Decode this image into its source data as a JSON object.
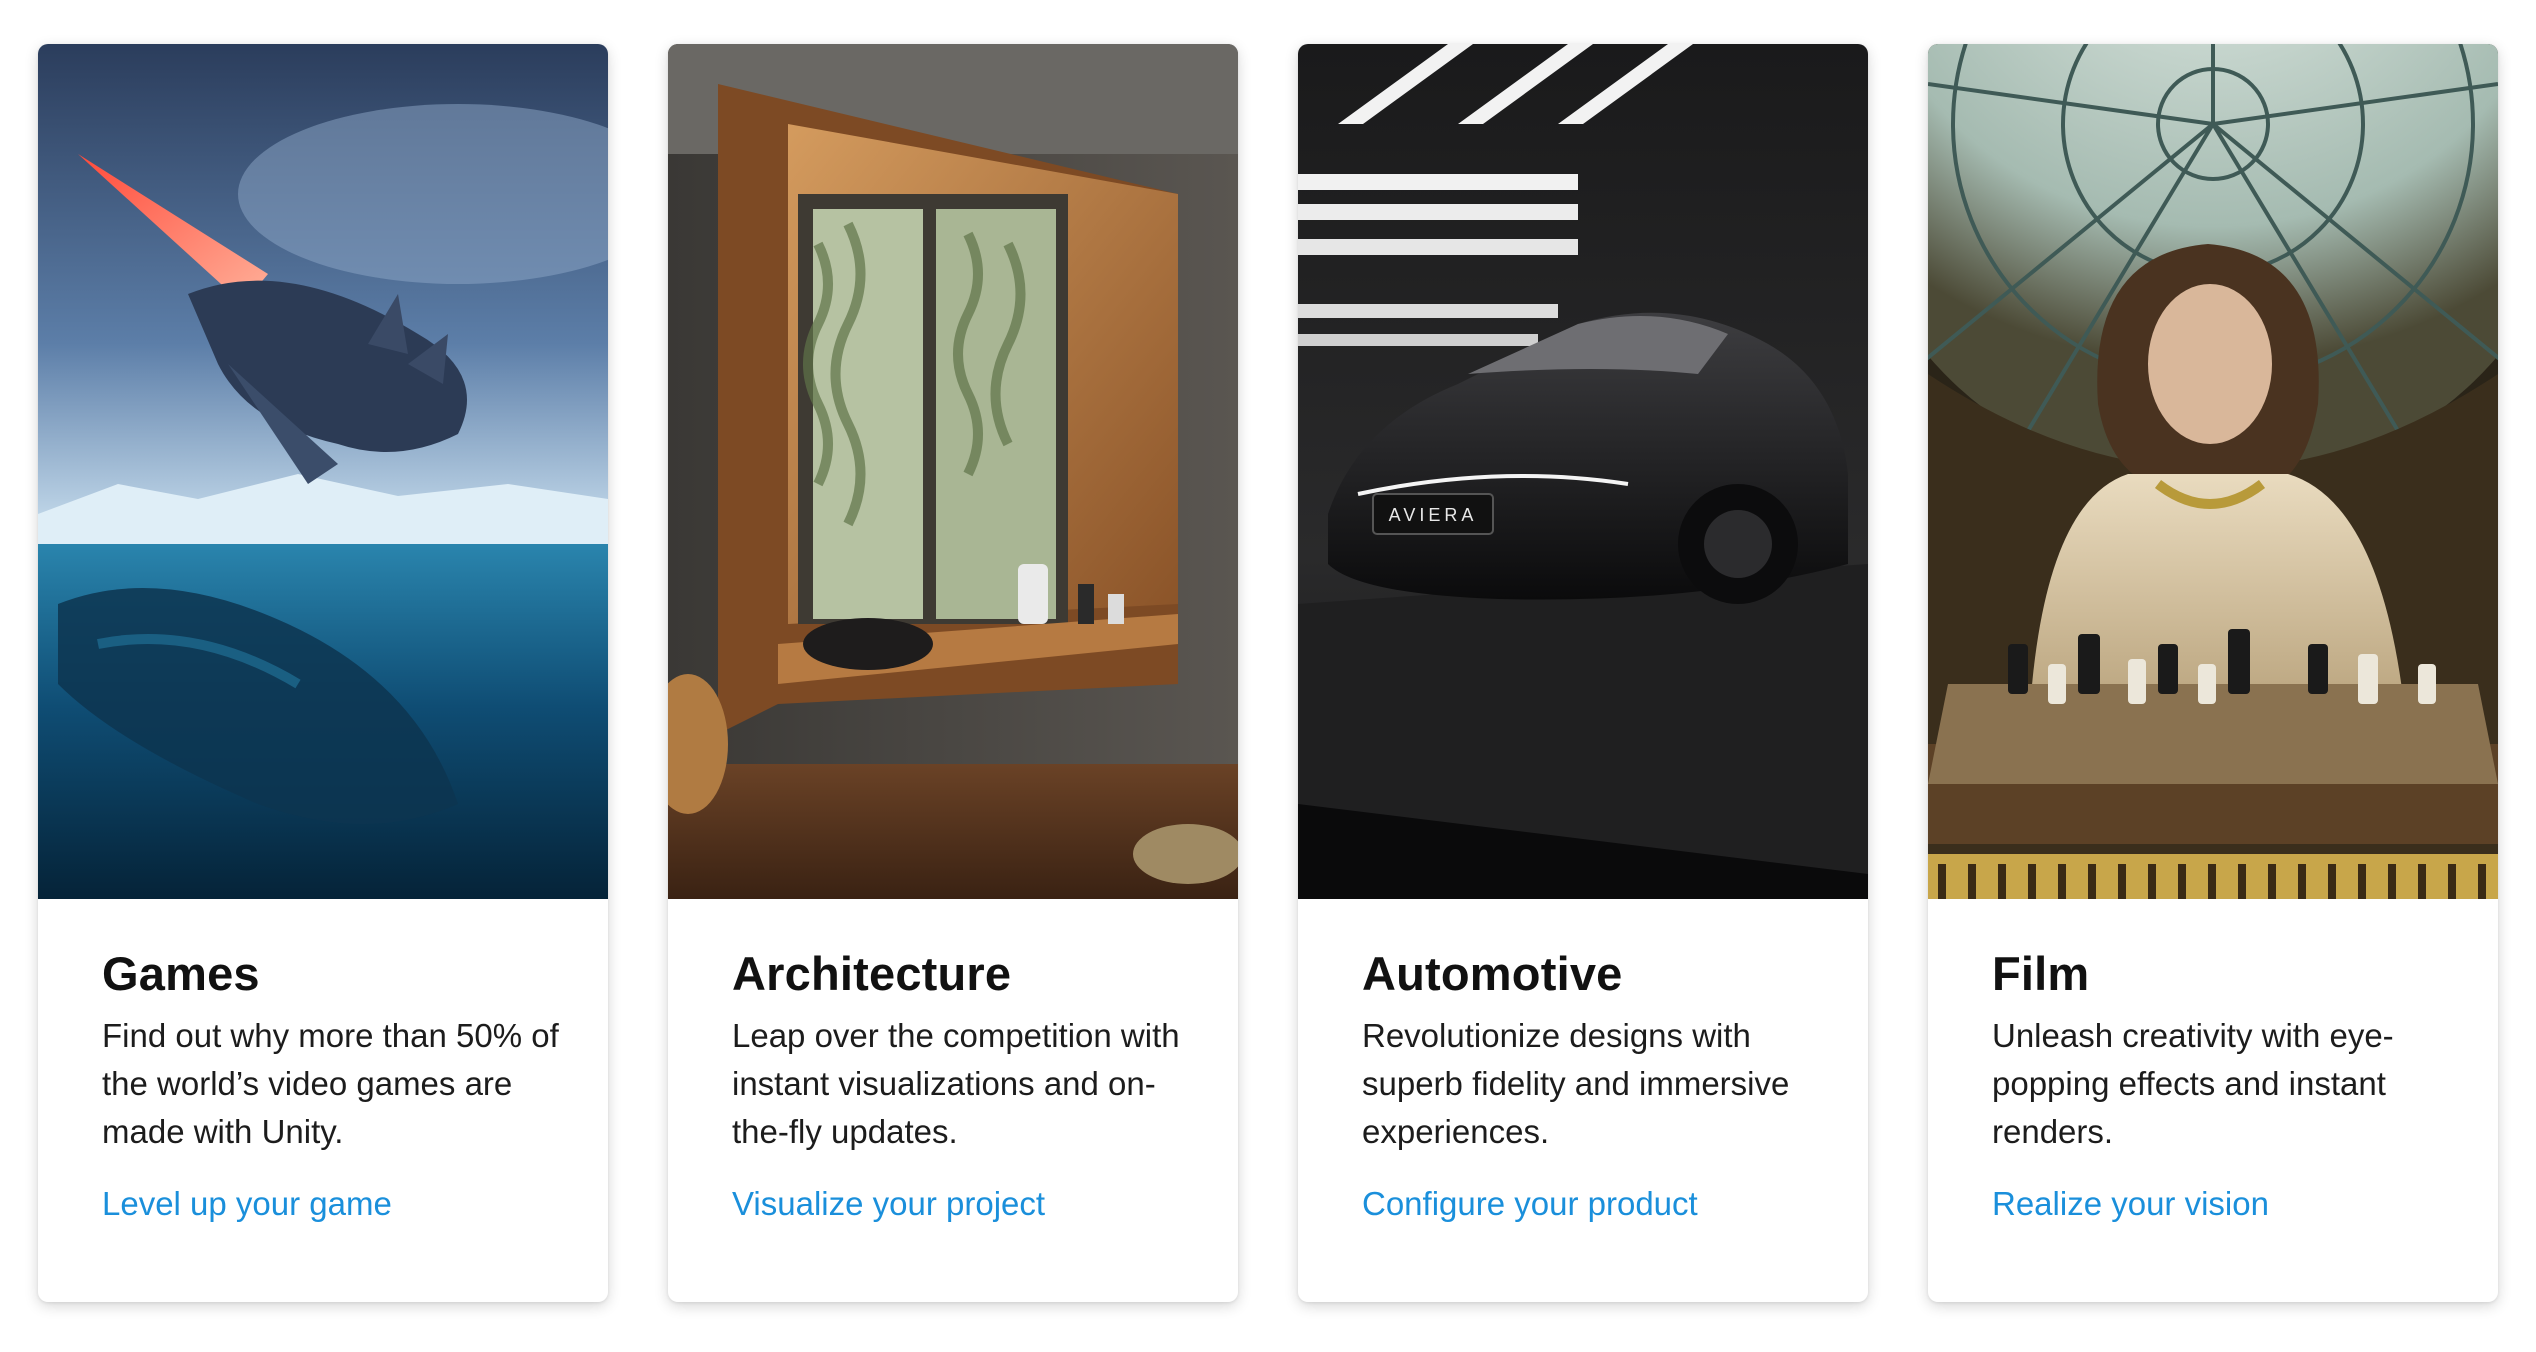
{
  "cards": [
    {
      "title": "Games",
      "description": "Find out why more than 50% of the world’s video games are made with Unity.",
      "link": "Level up your game",
      "image": "underwater-sea-creature-scene"
    },
    {
      "title": "Architecture",
      "description": "Leap over the competition with instant visualizations and on-the-fly updates.",
      "link": "Visualize your project",
      "image": "wooden-window-nook-interior"
    },
    {
      "title": "Automotive",
      "description": "Revolutionize designs with superb fidelity and immersive experiences.",
      "link": "Configure your product",
      "image": "black-sports-car-studio",
      "image_text": "AVIERA"
    },
    {
      "title": "Film",
      "description": "Unleash creativity with eye-popping effects and instant renders.",
      "link": "Realize your vision",
      "image": "woman-playing-chess-dome"
    }
  ],
  "colors": {
    "link": "#1a8fdb",
    "title": "#111111",
    "text": "#1c1c1c"
  }
}
